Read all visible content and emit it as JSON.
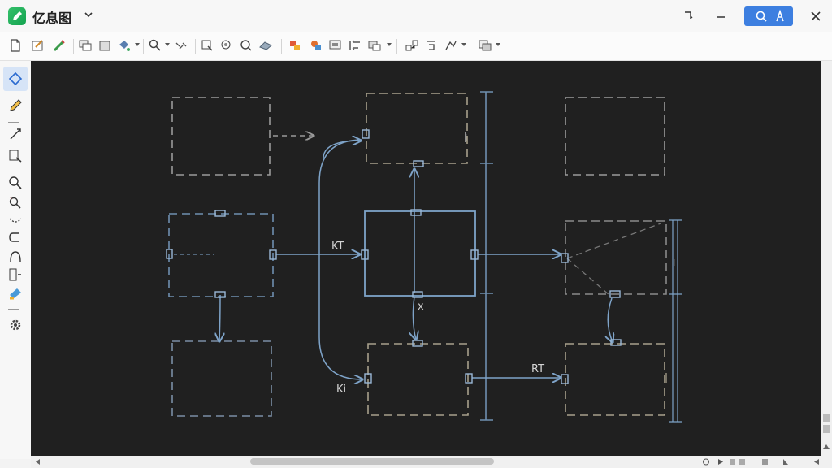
{
  "app": {
    "title": "亿息图"
  },
  "canvas": {
    "labels": {
      "kt": "KT",
      "x": "x",
      "rt": "RT",
      "ki": "Ki",
      "i1": "I",
      "i2": "I"
    }
  },
  "colors": {
    "canvas_bg": "#202020",
    "accent_blue": "#3d7fe0",
    "box_gray": "#9a9a9a",
    "box_tan": "#a8a08c",
    "box_blue": "#6f8fb0",
    "connector_blue": "#7ea3c8"
  },
  "icons": {
    "toolbar": [
      "new-page-icon",
      "edit-style-icon",
      "brush-icon",
      "duplicate-icon",
      "copy-icon",
      "paint-icon",
      "search-icon",
      "expand-icon",
      "select-icon",
      "tag-search-icon",
      "zoom-icon",
      "eraser-icon",
      "layer-color-icon",
      "layer-paint-icon",
      "arrange-icon",
      "align-icon",
      "group-icon",
      "connect-icon",
      "link-icon",
      "path-icon",
      "layout-icon"
    ],
    "left": [
      "select-diamond-icon",
      "pencil-icon",
      "line-icon",
      "text-box-icon",
      "zoom-in-icon",
      "zoom-magic-icon",
      "curve-icon",
      "loop-icon",
      "arc-icon",
      "container-icon",
      "fill-icon",
      "settings-icon"
    ]
  }
}
